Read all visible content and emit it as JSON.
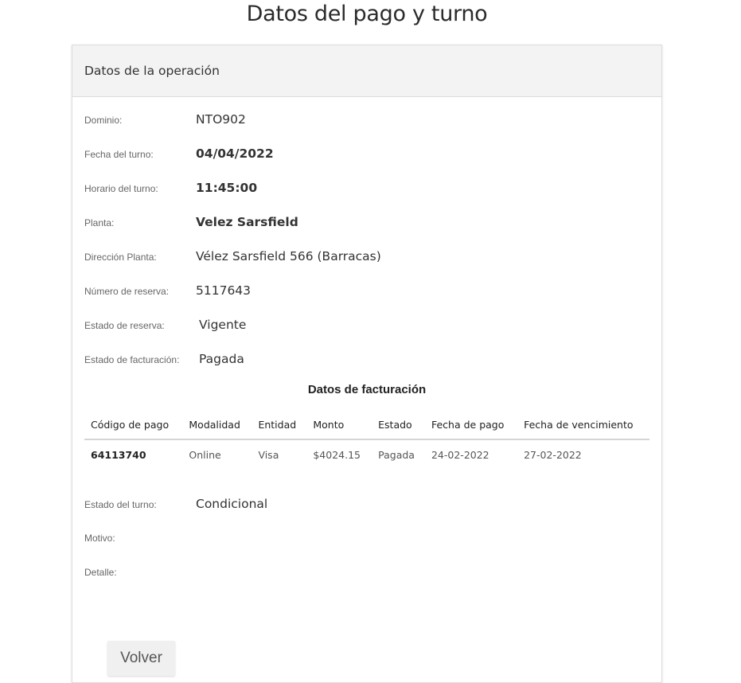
{
  "page": {
    "title": "Datos del pago y turno"
  },
  "card": {
    "header": "Datos de la operación"
  },
  "fields": {
    "dominio": {
      "label": "Dominio:",
      "value": "NTO902"
    },
    "fecha_turno": {
      "label": "Fecha del turno:",
      "value": "04/04/2022"
    },
    "horario_turno": {
      "label": "Horario del turno:",
      "value": "11:45:00"
    },
    "planta": {
      "label": "Planta:",
      "value": "Velez Sarsfield"
    },
    "direccion_planta": {
      "label": "Dirección Planta:",
      "value": "Vélez Sarsfield 566 (Barracas)"
    },
    "numero_reserva": {
      "label": "Número de reserva:",
      "value": "5117643"
    },
    "estado_reserva": {
      "label": "Estado de reserva:",
      "value": "Vigente"
    },
    "estado_facturacion": {
      "label": "Estado de facturación:",
      "value": "Pagada"
    },
    "estado_turno": {
      "label": "Estado del turno:",
      "value": "Condicional"
    },
    "motivo": {
      "label": "Motivo:",
      "value": ""
    },
    "detalle": {
      "label": "Detalle:",
      "value": ""
    }
  },
  "billing": {
    "title": "Datos de facturación",
    "columns": [
      "Código de pago",
      "Modalidad",
      "Entidad",
      "Monto",
      "Estado",
      "Fecha de pago",
      "Fecha de vencimiento"
    ],
    "rows": [
      [
        "64113740",
        "Online",
        "Visa",
        "$4024.15",
        "Pagada",
        "24-02-2022",
        "27-02-2022"
      ]
    ]
  },
  "actions": {
    "back_label": "Volver"
  }
}
